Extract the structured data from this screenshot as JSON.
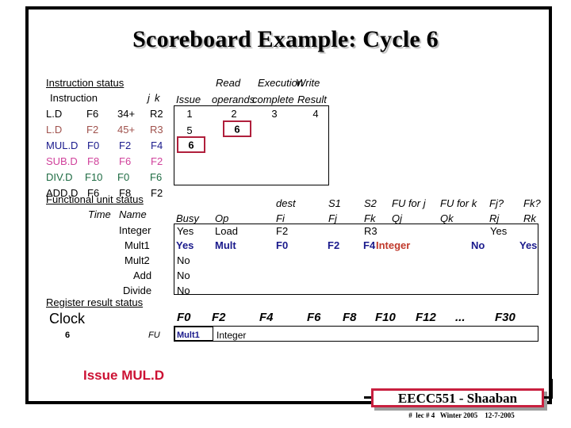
{
  "slide": {
    "title": "Scoreboard Example:  Cycle 6",
    "caption": "Issue MUL.D"
  },
  "instruction_status": {
    "section_label": "Instruction status",
    "col_instruction": "Instruction",
    "col_j": "j",
    "col_k": "k",
    "headers_top": [
      "",
      "Read",
      "Execution",
      "Write"
    ],
    "headers_bottom": [
      "Issue",
      "operands",
      "complete",
      "Result"
    ],
    "rows": [
      {
        "op": "L.D",
        "dest": "F6",
        "j": "34+",
        "k": "R2",
        "color": "#000000",
        "issue": "1",
        "read": "2",
        "exec": "3",
        "write": "4"
      },
      {
        "op": "L.D",
        "dest": "F2",
        "j": "45+",
        "k": "R3",
        "color": "#a0524d",
        "issue": "5",
        "read": "6",
        "exec": "",
        "write": ""
      },
      {
        "op": "MUL.D",
        "dest": "F0",
        "j": "F2",
        "k": "F4",
        "color": "#1a1a8c",
        "issue": "6",
        "read": "",
        "exec": "",
        "write": ""
      },
      {
        "op": "SUB.D",
        "dest": "F8",
        "j": "F6",
        "k": "F2",
        "color": "#d0419b",
        "issue": "",
        "read": "",
        "exec": "",
        "write": ""
      },
      {
        "op": "DIV.D",
        "dest": "F10",
        "j": "F0",
        "k": "F6",
        "color": "#1d6b42",
        "issue": "",
        "read": "",
        "exec": "",
        "write": ""
      },
      {
        "op": "ADD.D",
        "dest": "F6",
        "j": "F8",
        "k": "F2",
        "color": "#000000",
        "issue": "",
        "read": "",
        "exec": "",
        "write": ""
      }
    ],
    "highlights": [
      {
        "value": "6",
        "column": "read",
        "row": 1
      },
      {
        "value": "6",
        "column": "issue",
        "row": 2
      }
    ]
  },
  "fu_status": {
    "section_label": "Functional unit status",
    "col_time": "Time",
    "col_name": "Name",
    "headers_top": [
      "",
      "",
      "dest",
      "S1",
      "S2",
      "FU for j",
      "FU for k",
      "Fj?",
      "Fk?"
    ],
    "headers_bottom": [
      "Busy",
      "Op",
      "Fi",
      "Fj",
      "Fk",
      "Qj",
      "Qk",
      "Rj",
      "Rk"
    ],
    "rows": [
      {
        "name": "Integer",
        "busy": "Yes",
        "op": "Load",
        "fi": "F2",
        "fj": "",
        "fk": "R3",
        "qj": "",
        "qk": "",
        "rj": "",
        "rk": "Yes",
        "style": "plain"
      },
      {
        "name": "Mult1",
        "busy": "Yes",
        "op": "Mult",
        "fi": "F0",
        "fj": "F2",
        "fk": "F4",
        "qj": "",
        "qk": "Integer",
        "rj": "No",
        "rk": "Yes",
        "style": "bold-navy"
      },
      {
        "name": "Mult2",
        "busy": "No",
        "op": "",
        "fi": "",
        "fj": "",
        "fk": "",
        "qj": "",
        "qk": "",
        "rj": "",
        "rk": "",
        "style": "plain"
      },
      {
        "name": "Add",
        "busy": "No",
        "op": "",
        "fi": "",
        "fj": "",
        "fk": "",
        "qj": "",
        "qk": "",
        "rj": "",
        "rk": "",
        "style": "plain"
      },
      {
        "name": "Divide",
        "busy": "No",
        "op": "",
        "fi": "",
        "fj": "",
        "fk": "",
        "qj": "",
        "qk": "",
        "rj": "",
        "rk": "",
        "style": "plain"
      }
    ]
  },
  "register_result_status": {
    "section_label": "Register result status",
    "clock_label": "Clock",
    "clock_value": "6",
    "fu_label": "FU",
    "registers": [
      "F0",
      "F2",
      "F4",
      "F6",
      "F8",
      "F10",
      "F12",
      "...",
      "F30"
    ],
    "values": [
      "Mult1",
      "Integer",
      "",
      "",
      "",
      "",
      "",
      "",
      ""
    ]
  },
  "footer": {
    "signature": "EECC551 - Shaaban",
    "note": "#  lec # 4   Winter 2005    12-7-2005"
  },
  "colors": {
    "highlight_red": "#b01f3c",
    "caption_red": "#cc1133",
    "navy": "#1a1a8c",
    "qk_red": "#c0392b",
    "sig_border": "#c8203f"
  }
}
